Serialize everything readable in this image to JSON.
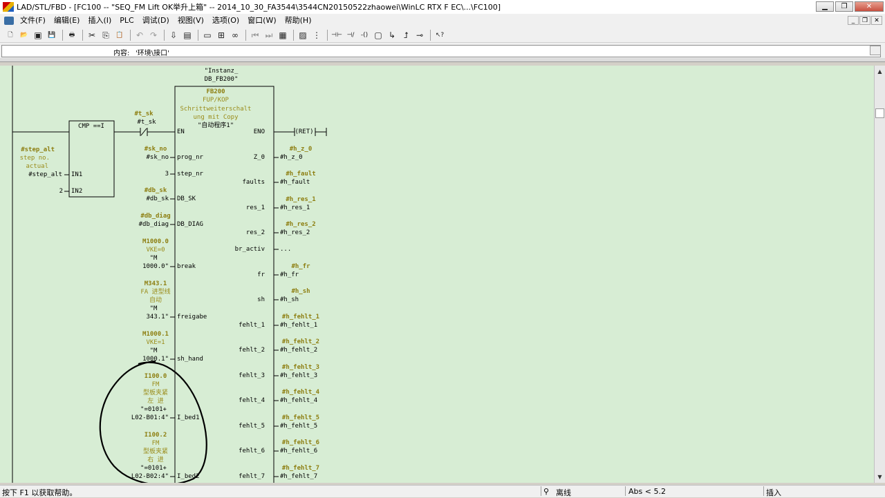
{
  "window": {
    "title": "LAD/STL/FBD  - [FC100 -- \"SEQ_FM Lift OK举升上箱\" -- 2014_10_30_FA3544\\3544CN20150522zhaowei\\WinLC RTX F EC\\...\\FC100]",
    "buttons": [
      "▁",
      "❐",
      "✕"
    ]
  },
  "menu": {
    "items": [
      "文件(F)",
      "编辑(E)",
      "插入(I)",
      "PLC",
      "调试(D)",
      "视图(V)",
      "选项(O)",
      "窗口(W)",
      "帮助(H)"
    ],
    "mdi_buttons": [
      "_",
      "❐",
      "✕"
    ]
  },
  "toolbar": {
    "icons": [
      {
        "name": "new-icon",
        "glyph": "🗋"
      },
      {
        "name": "open-icon",
        "glyph": "📂"
      },
      {
        "name": "accessible-nodes-icon",
        "glyph": "▣"
      },
      {
        "name": "save-icon",
        "glyph": "💾"
      },
      {
        "name": "print-icon",
        "glyph": "🖶"
      },
      {
        "name": "cut-icon",
        "glyph": "✂"
      },
      {
        "name": "copy-icon",
        "glyph": "⎘"
      },
      {
        "name": "paste-icon",
        "glyph": "📋"
      },
      {
        "name": "undo-icon",
        "glyph": "↶"
      },
      {
        "name": "redo-icon",
        "glyph": "↷"
      },
      {
        "name": "download-icon",
        "glyph": "⇩"
      },
      {
        "name": "monitor-icon",
        "glyph": "▤"
      },
      {
        "name": "overview-icon",
        "glyph": "▭"
      },
      {
        "name": "network-icon",
        "glyph": "⊞"
      },
      {
        "name": "glasses-icon",
        "glyph": "∞"
      },
      {
        "name": "nav-first-icon",
        "glyph": "⏮"
      },
      {
        "name": "nav-last-icon",
        "glyph": "⏭"
      },
      {
        "name": "layout-icon",
        "glyph": "▦"
      },
      {
        "name": "image-icon",
        "glyph": "▨"
      },
      {
        "name": "sequence-icon",
        "glyph": "⋮"
      },
      {
        "name": "contact-no-icon",
        "glyph": "⊣⊢"
      },
      {
        "name": "contact-nc-icon",
        "glyph": "⊣/⊢"
      },
      {
        "name": "coil-icon",
        "glyph": "-()"
      },
      {
        "name": "box-icon",
        "glyph": "▢"
      },
      {
        "name": "branch-open-icon",
        "glyph": "↳"
      },
      {
        "name": "branch-close-icon",
        "glyph": "⮥"
      },
      {
        "name": "connection-icon",
        "glyph": "⊸"
      },
      {
        "name": "help-pointer-icon",
        "glyph": "↖?"
      }
    ]
  },
  "info": {
    "label": "内容:",
    "value": "'环境\\接口'"
  },
  "ladder": {
    "instance": [
      "\"Instanz_",
      "DB_FB200\""
    ],
    "fb_header": [
      "FB200",
      "FUP/KOP",
      "Schrittweiterschalt",
      "ung mit Copy",
      "\"自动程序1\""
    ],
    "cmp": {
      "title": "CMP ==I",
      "in1": "IN1",
      "in2": "IN2",
      "in1_operand": [
        "#step_alt",
        "step no.",
        "actual",
        "#step_alt"
      ],
      "in2_operand": "2"
    },
    "contact": [
      "#t_sk",
      "#t_sk"
    ],
    "ret": "(RET)",
    "left_pins": [
      {
        "pin": "EN",
        "ops": []
      },
      {
        "pin": "prog_nr",
        "ops": [
          "#sk_no",
          "#sk_no"
        ]
      },
      {
        "pin": "step_nr",
        "ops": [
          "3"
        ]
      },
      {
        "pin": "DB_SK",
        "ops": [
          "#db_sk",
          "#db_sk"
        ]
      },
      {
        "pin": "DB_DIAG",
        "ops": [
          "#db_diag",
          "#db_diag"
        ]
      },
      {
        "pin": "break",
        "ops": [
          "M1000.0",
          "VKE=0",
          "\"M",
          "1000.0\""
        ]
      },
      {
        "pin": "freigabe",
        "ops": [
          "M343.1",
          "FA 进型线",
          "自动",
          "\"M",
          "343.1\""
        ]
      },
      {
        "pin": "sh_hand",
        "ops": [
          "M1000.1",
          "VKE=1",
          "\"M",
          "1000.1\""
        ]
      },
      {
        "pin": "I_bed1",
        "ops": [
          "I100.0",
          "FM",
          "型板夹紧",
          "左 进",
          "\"=0101+",
          "L02-B01:4\""
        ]
      },
      {
        "pin": "I_bed2",
        "ops": [
          "I100.2",
          "FM",
          "型板夹紧",
          "右 进",
          "\"=0101+",
          "L02-B02:4\""
        ]
      }
    ],
    "right_pins": [
      {
        "pin": "ENO",
        "ops": []
      },
      {
        "pin": "Z_0",
        "ops": [
          "#h_z_0",
          "#h_z_0"
        ]
      },
      {
        "pin": "faults",
        "ops": [
          "#h_fault",
          "#h_fault"
        ]
      },
      {
        "pin": "res_1",
        "ops": [
          "#h_res_1",
          "#h_res_1"
        ]
      },
      {
        "pin": "res_2",
        "ops": [
          "#h_res_2",
          "#h_res_2"
        ]
      },
      {
        "pin": "br_activ",
        "ops": [
          "..."
        ]
      },
      {
        "pin": "fr",
        "ops": [
          "#h_fr",
          "#h_fr"
        ]
      },
      {
        "pin": "sh",
        "ops": [
          "#h_sh",
          "#h_sh"
        ]
      },
      {
        "pin": "fehlt_1",
        "ops": [
          "#h_fehlt_1",
          "#h_fehlt_1"
        ]
      },
      {
        "pin": "fehlt_2",
        "ops": [
          "#h_fehlt_2",
          "#h_fehlt_2"
        ]
      },
      {
        "pin": "fehlt_3",
        "ops": [
          "#h_fehlt_3",
          "#h_fehlt_3"
        ]
      },
      {
        "pin": "fehlt_4",
        "ops": [
          "#h_fehlt_4",
          "#h_fehlt_4"
        ]
      },
      {
        "pin": "fehlt_5",
        "ops": [
          "#h_fehlt_5",
          "#h_fehlt_5"
        ]
      },
      {
        "pin": "fehlt_6",
        "ops": [
          "#h_fehlt_6",
          "#h_fehlt_6"
        ]
      },
      {
        "pin": "fehlt_7",
        "ops": [
          "#h_fehlt_7",
          "#h_fehlt_7"
        ]
      }
    ]
  },
  "status": {
    "help": "按下 F1 以获取帮助。",
    "online": "离线",
    "abs": "Abs < 5.2",
    "mode": "插入"
  },
  "colors": {
    "editor_bg": "#d7edd4",
    "operand_comment": "#9a8c1a",
    "annotation": "#000000"
  }
}
